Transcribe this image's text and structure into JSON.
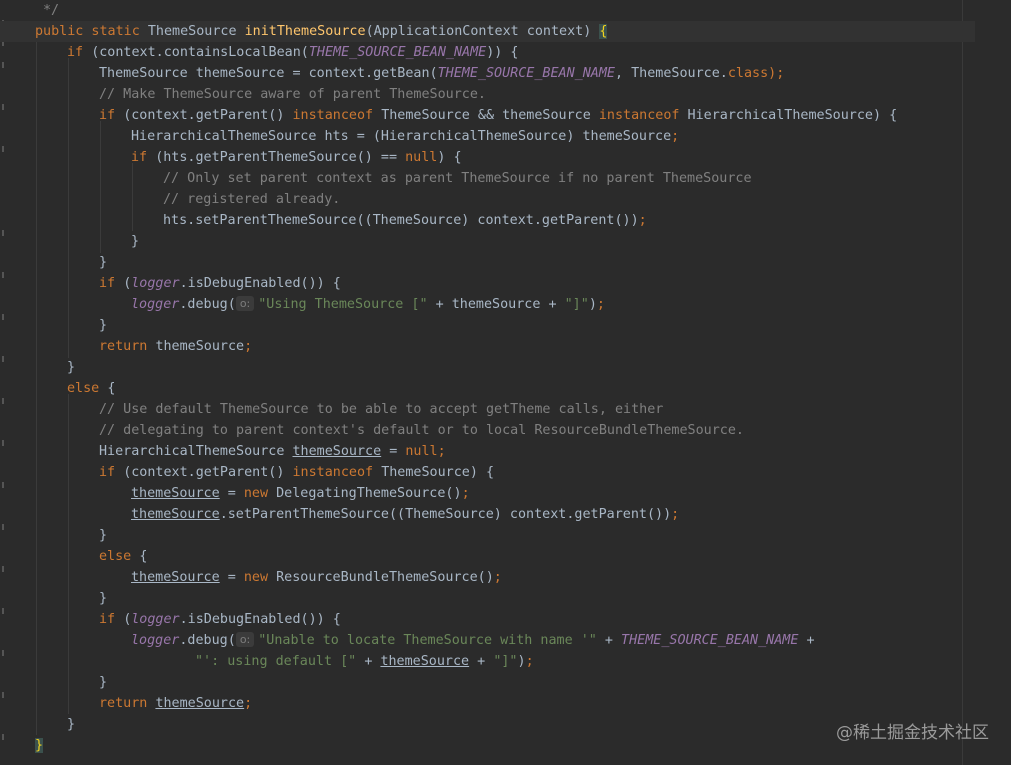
{
  "lines": {
    "l0": "*/",
    "l1": {
      "a": "public static ",
      "b": "ThemeSource ",
      "c": "initThemeSource",
      "d": "(ApplicationContext context) ",
      "e": "{"
    },
    "l2": {
      "a": "if ",
      "b": "(context.containsLocalBean(",
      "c": "THEME_SOURCE_BEAN_NAME",
      "d": ")) {"
    },
    "l3": {
      "a": "ThemeSource themeSource = context.getBean(",
      "b": "THEME_SOURCE_BEAN_NAME",
      "c": ", ThemeSource.",
      "d": "class",
      "e": ");"
    },
    "l4": "// Make ThemeSource aware of parent ThemeSource.",
    "l5": {
      "a": "if ",
      "b": "(context.getParent() ",
      "c": "instanceof ",
      "d": "ThemeSource && themeSource ",
      "e": "instanceof ",
      "f": "HierarchicalThemeSource) {"
    },
    "l6": {
      "a": "HierarchicalThemeSource hts = (HierarchicalThemeSource) themeSource",
      "b": ";"
    },
    "l7": {
      "a": "if ",
      "b": "(hts.getParentThemeSource() == ",
      "c": "null",
      "d": ") {"
    },
    "l8": "// Only set parent context as parent ThemeSource if no parent ThemeSource",
    "l9": "// registered already.",
    "l10": {
      "a": "hts.setParentThemeSource((ThemeSource) context.getParent())",
      "b": ";"
    },
    "l11": "}",
    "l12": "}",
    "l13": {
      "a": "if ",
      "b": "(",
      "c": "logger",
      "d": ".isDebugEnabled()) {"
    },
    "l14": {
      "a": "logger",
      "b": ".debug(",
      "hint": "o:",
      "c": "\"Using ThemeSource [\" ",
      "d": "+ themeSource + ",
      "e": "\"]\"",
      "f": ")",
      "g": ";"
    },
    "l15": "}",
    "l16": {
      "a": "return ",
      "b": "themeSource",
      "c": ";"
    },
    "l17": "}",
    "l18": {
      "a": "else ",
      "b": "{"
    },
    "l19": "// Use default ThemeSource to be able to accept getTheme calls, either",
    "l20": "// delegating to parent context's default or to local ResourceBundleThemeSource.",
    "l21": {
      "a": "HierarchicalThemeSource ",
      "b": "themeSource",
      "c": " = ",
      "d": "null",
      "e": ";"
    },
    "l22": {
      "a": "if ",
      "b": "(context.getParent() ",
      "c": "instanceof ",
      "d": "ThemeSource) {"
    },
    "l23": {
      "a": "themeSource",
      "b": " = ",
      "c": "new ",
      "d": "DelegatingThemeSource()",
      "e": ";"
    },
    "l24": {
      "a": "themeSource",
      "b": ".setParentThemeSource((ThemeSource) context.getParent())",
      "c": ";"
    },
    "l25": "}",
    "l26": {
      "a": "else ",
      "b": "{"
    },
    "l27": {
      "a": "themeSource",
      "b": " = ",
      "c": "new ",
      "d": "ResourceBundleThemeSource()",
      "e": ";"
    },
    "l28": "}",
    "l29": {
      "a": "if ",
      "b": "(",
      "c": "logger",
      "d": ".isDebugEnabled()) {"
    },
    "l30": {
      "a": "logger",
      "b": ".debug(",
      "hint": "o:",
      "c": "\"Unable to locate ThemeSource with name '\" ",
      "d": "+ ",
      "e": "THEME_SOURCE_BEAN_NAME",
      "f": " +"
    },
    "l31": {
      "a": "\"': using default [\" ",
      "b": "+ ",
      "c": "themeSource",
      "d": " + ",
      "e": "\"]\"",
      "f": ")",
      "g": ";"
    },
    "l32": "}",
    "l33": {
      "a": "return ",
      "b": "themeSource",
      "c": ";"
    },
    "l34": "}",
    "l35": "}"
  },
  "watermark": "@稀土掘金技术社区",
  "colors": {
    "background": "#2b2b2b",
    "keyword": "#cc7832",
    "method_decl": "#ffc66d",
    "comment": "#808080",
    "string": "#6a8759",
    "constant": "#9876aa",
    "text": "#a9b7c6"
  }
}
